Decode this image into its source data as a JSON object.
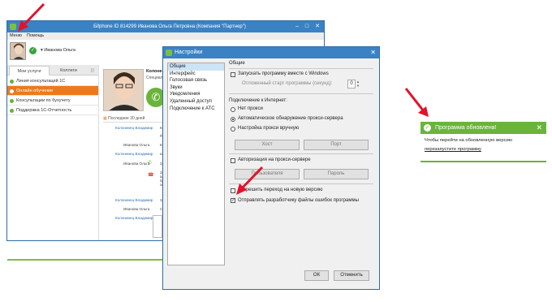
{
  "main_window": {
    "title": "Бifphone ID 814299 Иванова Ольга Петровна (Компания \"Партнер\")",
    "minimize_icon": "minimize-icon",
    "maximize_icon": "maximize-icon",
    "close_icon": "close-icon",
    "menu": [
      "Меню",
      "Помощь"
    ],
    "profile_name": "Иванова Ольга",
    "tabs": [
      "Мои услуги",
      "Коллеги",
      "|||"
    ],
    "lines": [
      {
        "label": "Линия консультаций 1С",
        "active": false
      },
      {
        "label": "Онлайн обучение",
        "active": true
      },
      {
        "label": "Консультации по бухучету",
        "active": false
      },
      {
        "label": "Поддержка 1С-Отчетность",
        "active": false
      }
    ],
    "contact_name": "Колоне",
    "contact_sub": "Специал",
    "history_header": "Последние 30 дней",
    "history": [
      {
        "name": "Колонинец Владимир",
        "text": "Коне",
        "link": true
      },
      {
        "name": "",
        "text": "до, быст",
        "link": false
      },
      {
        "name": "Иванова Ольга",
        "text": "Коне",
        "link": false
      },
      {
        "name": "Колонинец Владимир",
        "text": "коне",
        "link": true
      },
      {
        "name": "Иванова Ольга",
        "text": "Закончено",
        "link": false
      },
      {
        "name": "",
        "text": "Заве алекс пр ой",
        "link": false
      },
      {
        "name": "Колонинец Владимир",
        "text": "Зако",
        "link": true
      },
      {
        "name": "Иванова Ольга",
        "text": "Спас",
        "link": false
      },
      {
        "name": "Колонинец Владимир",
        "text": "Вов",
        "link": true
      }
    ]
  },
  "settings": {
    "title": "Настройки",
    "nav": [
      "Общие",
      "Интерфейс",
      "Голосовая связь",
      "Звуки",
      "Уведомления",
      "Удаленный доступ",
      "Подключение к АТС"
    ],
    "section_title": "Общие",
    "autostart_label": "Запускать программу вместе с Windows",
    "delay_label": "Отложенный старт программы (секунд):",
    "delay_value": "0",
    "internet_label": "Подключение к Интернет:",
    "proxy_options": [
      "Нет прокси",
      "Автоматическое обнаружение прокси-сервера",
      "Настройка прокси вручную"
    ],
    "host_placeholder": "Хост",
    "port_placeholder": "Порт",
    "proxy_auth_label": "Авторизация на прокси-сервере",
    "user_placeholder": "Пользователя",
    "password_placeholder": "Пароль",
    "allow_update_label": "Разрешить переход на новую версию",
    "send_errors_label": "Отправлять разработчику файлы ошибок программы",
    "ok_label": "ОК",
    "cancel_label": "Отменить"
  },
  "notification": {
    "title": "Программа обновлена!",
    "text": "Чтобы перейти на обновленную версию",
    "link": "перезапустите программу",
    "close": "✕"
  },
  "colors": {
    "title_bar": "#3a82c4",
    "accent_green": "#6ab43b",
    "active_orange": "#ec7a1c",
    "annotation_red": "#e3122a"
  }
}
